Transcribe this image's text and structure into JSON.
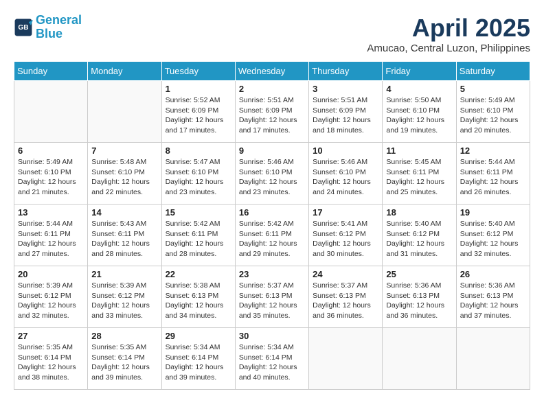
{
  "header": {
    "logo_line1": "General",
    "logo_line2": "Blue",
    "month_year": "April 2025",
    "location": "Amucao, Central Luzon, Philippines"
  },
  "weekdays": [
    "Sunday",
    "Monday",
    "Tuesday",
    "Wednesday",
    "Thursday",
    "Friday",
    "Saturday"
  ],
  "weeks": [
    [
      {
        "day": "",
        "sunrise": "",
        "sunset": "",
        "daylight": ""
      },
      {
        "day": "",
        "sunrise": "",
        "sunset": "",
        "daylight": ""
      },
      {
        "day": "1",
        "sunrise": "Sunrise: 5:52 AM",
        "sunset": "Sunset: 6:09 PM",
        "daylight": "Daylight: 12 hours and 17 minutes."
      },
      {
        "day": "2",
        "sunrise": "Sunrise: 5:51 AM",
        "sunset": "Sunset: 6:09 PM",
        "daylight": "Daylight: 12 hours and 17 minutes."
      },
      {
        "day": "3",
        "sunrise": "Sunrise: 5:51 AM",
        "sunset": "Sunset: 6:09 PM",
        "daylight": "Daylight: 12 hours and 18 minutes."
      },
      {
        "day": "4",
        "sunrise": "Sunrise: 5:50 AM",
        "sunset": "Sunset: 6:10 PM",
        "daylight": "Daylight: 12 hours and 19 minutes."
      },
      {
        "day": "5",
        "sunrise": "Sunrise: 5:49 AM",
        "sunset": "Sunset: 6:10 PM",
        "daylight": "Daylight: 12 hours and 20 minutes."
      }
    ],
    [
      {
        "day": "6",
        "sunrise": "Sunrise: 5:49 AM",
        "sunset": "Sunset: 6:10 PM",
        "daylight": "Daylight: 12 hours and 21 minutes."
      },
      {
        "day": "7",
        "sunrise": "Sunrise: 5:48 AM",
        "sunset": "Sunset: 6:10 PM",
        "daylight": "Daylight: 12 hours and 22 minutes."
      },
      {
        "day": "8",
        "sunrise": "Sunrise: 5:47 AM",
        "sunset": "Sunset: 6:10 PM",
        "daylight": "Daylight: 12 hours and 23 minutes."
      },
      {
        "day": "9",
        "sunrise": "Sunrise: 5:46 AM",
        "sunset": "Sunset: 6:10 PM",
        "daylight": "Daylight: 12 hours and 23 minutes."
      },
      {
        "day": "10",
        "sunrise": "Sunrise: 5:46 AM",
        "sunset": "Sunset: 6:10 PM",
        "daylight": "Daylight: 12 hours and 24 minutes."
      },
      {
        "day": "11",
        "sunrise": "Sunrise: 5:45 AM",
        "sunset": "Sunset: 6:11 PM",
        "daylight": "Daylight: 12 hours and 25 minutes."
      },
      {
        "day": "12",
        "sunrise": "Sunrise: 5:44 AM",
        "sunset": "Sunset: 6:11 PM",
        "daylight": "Daylight: 12 hours and 26 minutes."
      }
    ],
    [
      {
        "day": "13",
        "sunrise": "Sunrise: 5:44 AM",
        "sunset": "Sunset: 6:11 PM",
        "daylight": "Daylight: 12 hours and 27 minutes."
      },
      {
        "day": "14",
        "sunrise": "Sunrise: 5:43 AM",
        "sunset": "Sunset: 6:11 PM",
        "daylight": "Daylight: 12 hours and 28 minutes."
      },
      {
        "day": "15",
        "sunrise": "Sunrise: 5:42 AM",
        "sunset": "Sunset: 6:11 PM",
        "daylight": "Daylight: 12 hours and 28 minutes."
      },
      {
        "day": "16",
        "sunrise": "Sunrise: 5:42 AM",
        "sunset": "Sunset: 6:11 PM",
        "daylight": "Daylight: 12 hours and 29 minutes."
      },
      {
        "day": "17",
        "sunrise": "Sunrise: 5:41 AM",
        "sunset": "Sunset: 6:12 PM",
        "daylight": "Daylight: 12 hours and 30 minutes."
      },
      {
        "day": "18",
        "sunrise": "Sunrise: 5:40 AM",
        "sunset": "Sunset: 6:12 PM",
        "daylight": "Daylight: 12 hours and 31 minutes."
      },
      {
        "day": "19",
        "sunrise": "Sunrise: 5:40 AM",
        "sunset": "Sunset: 6:12 PM",
        "daylight": "Daylight: 12 hours and 32 minutes."
      }
    ],
    [
      {
        "day": "20",
        "sunrise": "Sunrise: 5:39 AM",
        "sunset": "Sunset: 6:12 PM",
        "daylight": "Daylight: 12 hours and 32 minutes."
      },
      {
        "day": "21",
        "sunrise": "Sunrise: 5:39 AM",
        "sunset": "Sunset: 6:12 PM",
        "daylight": "Daylight: 12 hours and 33 minutes."
      },
      {
        "day": "22",
        "sunrise": "Sunrise: 5:38 AM",
        "sunset": "Sunset: 6:13 PM",
        "daylight": "Daylight: 12 hours and 34 minutes."
      },
      {
        "day": "23",
        "sunrise": "Sunrise: 5:37 AM",
        "sunset": "Sunset: 6:13 PM",
        "daylight": "Daylight: 12 hours and 35 minutes."
      },
      {
        "day": "24",
        "sunrise": "Sunrise: 5:37 AM",
        "sunset": "Sunset: 6:13 PM",
        "daylight": "Daylight: 12 hours and 36 minutes."
      },
      {
        "day": "25",
        "sunrise": "Sunrise: 5:36 AM",
        "sunset": "Sunset: 6:13 PM",
        "daylight": "Daylight: 12 hours and 36 minutes."
      },
      {
        "day": "26",
        "sunrise": "Sunrise: 5:36 AM",
        "sunset": "Sunset: 6:13 PM",
        "daylight": "Daylight: 12 hours and 37 minutes."
      }
    ],
    [
      {
        "day": "27",
        "sunrise": "Sunrise: 5:35 AM",
        "sunset": "Sunset: 6:14 PM",
        "daylight": "Daylight: 12 hours and 38 minutes."
      },
      {
        "day": "28",
        "sunrise": "Sunrise: 5:35 AM",
        "sunset": "Sunset: 6:14 PM",
        "daylight": "Daylight: 12 hours and 39 minutes."
      },
      {
        "day": "29",
        "sunrise": "Sunrise: 5:34 AM",
        "sunset": "Sunset: 6:14 PM",
        "daylight": "Daylight: 12 hours and 39 minutes."
      },
      {
        "day": "30",
        "sunrise": "Sunrise: 5:34 AM",
        "sunset": "Sunset: 6:14 PM",
        "daylight": "Daylight: 12 hours and 40 minutes."
      },
      {
        "day": "",
        "sunrise": "",
        "sunset": "",
        "daylight": ""
      },
      {
        "day": "",
        "sunrise": "",
        "sunset": "",
        "daylight": ""
      },
      {
        "day": "",
        "sunrise": "",
        "sunset": "",
        "daylight": ""
      }
    ]
  ]
}
